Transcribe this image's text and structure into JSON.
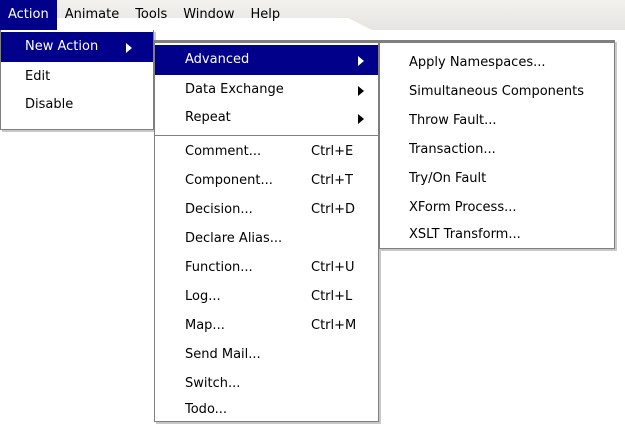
{
  "menubar": {
    "items": [
      {
        "label": "Action",
        "mnemonic": "A"
      },
      {
        "label": "Animate",
        "mnemonic": "n"
      },
      {
        "label": "Tools",
        "mnemonic": "T"
      },
      {
        "label": "Window",
        "mnemonic": "W"
      },
      {
        "label": "Help",
        "mnemonic": "H"
      }
    ]
  },
  "action_menu": {
    "items": [
      {
        "label": "New Action",
        "has_submenu": true,
        "highlighted": true
      },
      {
        "label": "Edit"
      },
      {
        "label": "Disable"
      }
    ]
  },
  "new_action_menu": {
    "items": [
      {
        "label": "Advanced",
        "has_submenu": true,
        "highlighted": true
      },
      {
        "label": "Data Exchange",
        "has_submenu": true
      },
      {
        "label": "Repeat",
        "has_submenu": true
      },
      {
        "label": "Comment...",
        "shortcut": "Ctrl+E"
      },
      {
        "label": "Component...",
        "shortcut": "Ctrl+T"
      },
      {
        "label": "Decision...",
        "shortcut": "Ctrl+D"
      },
      {
        "label": "Declare Alias..."
      },
      {
        "label": "Function...",
        "shortcut": "Ctrl+U"
      },
      {
        "label": "Log...",
        "shortcut": "Ctrl+L"
      },
      {
        "label": "Map...",
        "shortcut": "Ctrl+M"
      },
      {
        "label": "Send Mail..."
      },
      {
        "label": "Switch..."
      },
      {
        "label": "Todo..."
      }
    ]
  },
  "advanced_menu": {
    "items": [
      {
        "label": "Apply Namespaces..."
      },
      {
        "label": "Simultaneous Components"
      },
      {
        "label": "Throw Fault..."
      },
      {
        "label": "Transaction..."
      },
      {
        "label": "Try/On Fault"
      },
      {
        "label": "XForm Process..."
      },
      {
        "label": "XSLT Transform..."
      }
    ]
  },
  "colors": {
    "highlight": "#00008b",
    "highlight_text": "#ffffff"
  }
}
